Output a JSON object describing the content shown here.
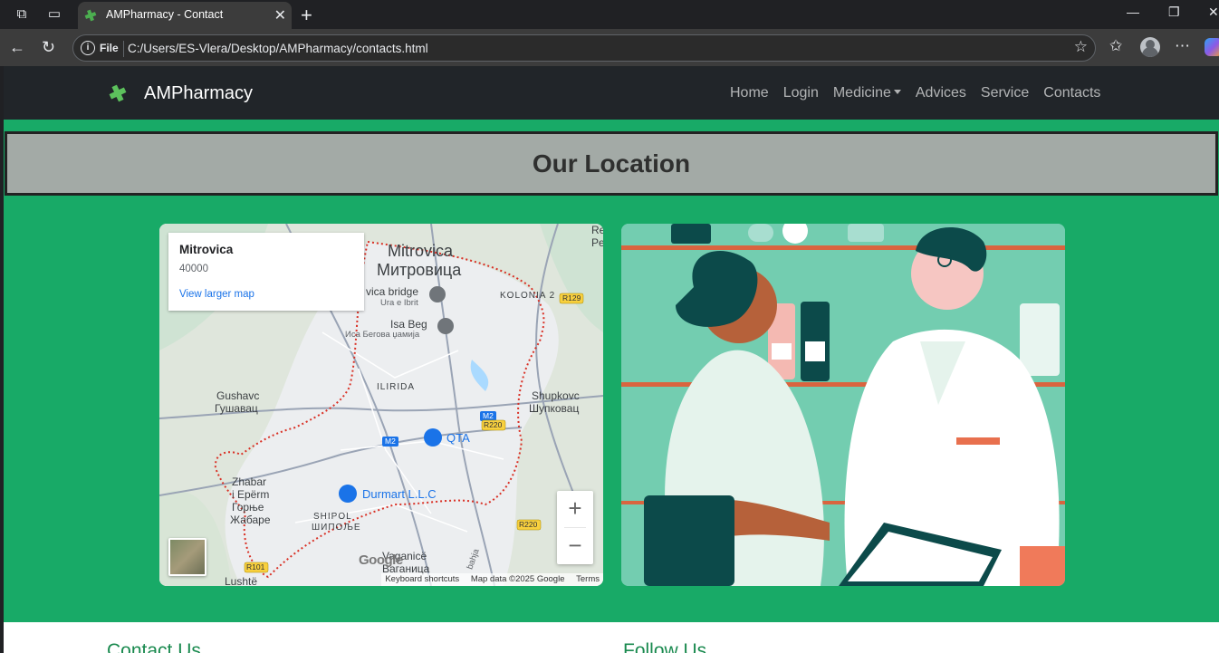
{
  "browser": {
    "tab_title": "AMPharmacy - Contact",
    "file_label": "File",
    "url": "C:/Users/ES-Vlera/Desktop/AMPharmacy/contacts.html"
  },
  "navbar": {
    "brand": "AMPharmacy",
    "links": [
      "Home",
      "Login",
      "Medicine",
      "Advices",
      "Service",
      "Contacts"
    ]
  },
  "section": {
    "title": "Our Location"
  },
  "map": {
    "place_name": "Mitrovica",
    "postal_code": "40000",
    "view_larger": "View larger map",
    "zoom_in": "+",
    "zoom_out": "−",
    "attribution": {
      "shortcuts": "Keyboard shortcuts",
      "data": "Map data ©2025 Google",
      "terms": "Terms"
    },
    "google_logo": "Google",
    "labels": {
      "city_latin": "Mitrovica",
      "city_cyr": "Митровица",
      "kolonia": "KOLONIA 2",
      "r129": "R129",
      "bridge": "vica bridge",
      "bridge_sub": "Ura e Ibrit",
      "isabeg": "Isa Beg",
      "isabeg_cyr": "Иса Бегова џамија",
      "ilirida": "ILIRIDA",
      "gushavc": "Gushavc",
      "gushavc_cyr": "Гушавац",
      "shupkovc": "Shupkovc",
      "shupkovc_cyr": "Шупковац",
      "m2a": "M2",
      "m2b": "M2",
      "r220a": "R220",
      "r220b": "R220",
      "qta": "QTA",
      "durmart": "Durmart L.L.C",
      "zhabar1": "Zhabar",
      "zhabar2": "i Epërm",
      "zhabar_cyr1": "Горње",
      "zhabar_cyr2": "Жабаре",
      "shipol": "SHIPOL",
      "shipol_cyr": "ШИПОЉЕ",
      "vaganice": "Vaganicë",
      "vaganice_cyr": "Ваганица",
      "r101": "R101",
      "lushte": "Lushtë",
      "re": "Re",
      "pe": "Pe",
      "bahja": "bahja"
    }
  },
  "footer": {
    "contact_heading": "Contact Us",
    "follow_heading": "Follow Us"
  },
  "colors": {
    "page_green": "#18aa67",
    "navbar": "#212529",
    "header_gray": "#a3aaa6",
    "illustration_bg": "#73cdb0"
  }
}
